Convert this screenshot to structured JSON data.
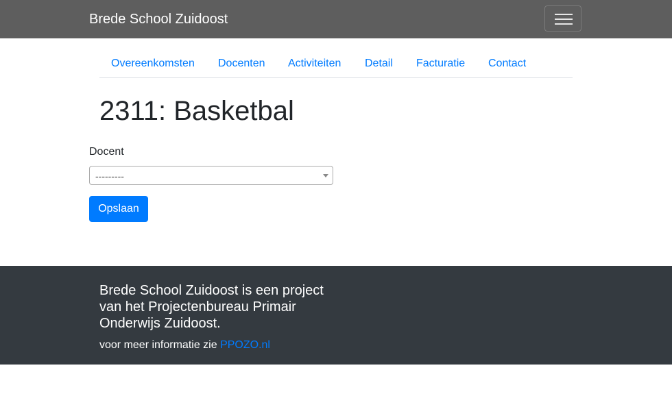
{
  "navbar": {
    "brand": "Brede School Zuidoost",
    "toggler_icon": "hamburger-menu-icon"
  },
  "tabs": [
    {
      "label": "Overeenkomsten"
    },
    {
      "label": "Docenten"
    },
    {
      "label": "Activiteiten"
    },
    {
      "label": "Detail"
    },
    {
      "label": "Facturatie"
    },
    {
      "label": "Contact"
    }
  ],
  "main": {
    "title": "2311: Basketbal",
    "docent_label": "Docent",
    "docent_value": "---------",
    "save_label": "Opslaan"
  },
  "footer": {
    "text": "Brede School Zuidoost is een project van het Projectenbureau Primair Onderwijs Zuidoost.",
    "info_prefix": "voor meer informatie zie ",
    "link_text": "PPOZO.nl"
  },
  "colors": {
    "navbar_bg": "#5e5e5e",
    "link": "#007bff",
    "primary_button": "#007bff",
    "footer_bg": "#343a40"
  }
}
